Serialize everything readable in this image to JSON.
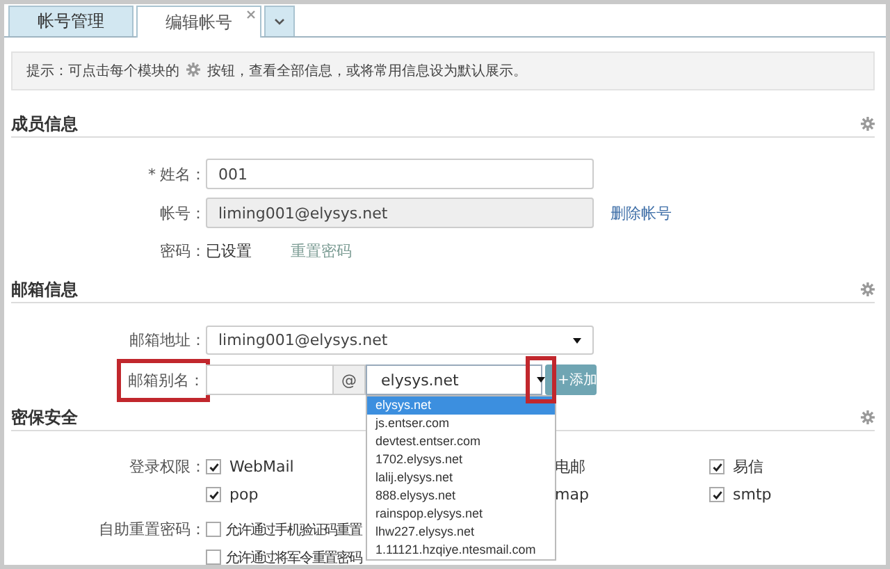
{
  "tabs": [
    {
      "label": "帐号管理",
      "selected": false,
      "closable": false
    },
    {
      "label": "编辑帐号",
      "selected": true,
      "closable": true
    }
  ],
  "hint": {
    "prefix": "提示：可点击每个模块的",
    "suffix": "按钮，查看全部信息，或将常用信息设为默认展示。"
  },
  "sections": [
    {
      "title": "成员信息",
      "rows": [
        {
          "kind": "text_input",
          "marker": "*",
          "label": "姓名：",
          "value": "001"
        },
        {
          "kind": "readonly_input",
          "label": "帐号：",
          "value": "liming001@elysys.net",
          "link": "删除帐号"
        },
        {
          "kind": "static",
          "label": "密码：",
          "value": "已设置",
          "link": "重置密码"
        }
      ]
    },
    {
      "title": "邮箱信息",
      "rows": [
        {
          "kind": "select",
          "label": "邮箱地址：",
          "value": "liming001@elysys.net"
        },
        {
          "kind": "alias",
          "label": "邮箱别名：",
          "highlighted": true,
          "at": "@",
          "domain": "elysys.net",
          "arrow_highlighted": true,
          "button": "+添加",
          "options": [
            {
              "label": "elysys.net",
              "selected": true
            },
            {
              "label": "js.entser.com",
              "selected": false
            },
            {
              "label": "devtest.entser.com",
              "selected": false
            },
            {
              "label": "1702.elysys.net",
              "selected": false
            },
            {
              "label": "lalij.elysys.net",
              "selected": false
            },
            {
              "label": "888.elysys.net",
              "selected": false
            },
            {
              "label": "rainspop.elysys.net",
              "selected": false
            },
            {
              "label": "lhw227.elysys.net",
              "selected": false
            },
            {
              "label": "1.11121.hzqiye.ntesmail.com",
              "selected": false
            }
          ]
        }
      ]
    },
    {
      "title": "密保安全",
      "rows": [
        {
          "kind": "checks",
          "label": "登录权限：",
          "items": [
            {
              "kind": "full",
              "label": "WebMail",
              "checked": true
            },
            {
              "kind": "partial",
              "label": "电邮"
            },
            {
              "kind": "full",
              "label": "易信",
              "checked": true
            },
            {
              "kind": "full",
              "label": "pop",
              "checked": true
            },
            {
              "kind": "partial",
              "label": "map"
            },
            {
              "kind": "full",
              "label": "smtp",
              "checked": true
            }
          ]
        },
        {
          "kind": "checklist",
          "label": "自助重置密码：",
          "items": [
            {
              "kind": "full",
              "label": "允许通过手机验证码重置",
              "checked": false
            },
            {
              "kind": "full",
              "label": "允许通过将军令重置密码",
              "checked": false
            }
          ]
        }
      ]
    }
  ]
}
